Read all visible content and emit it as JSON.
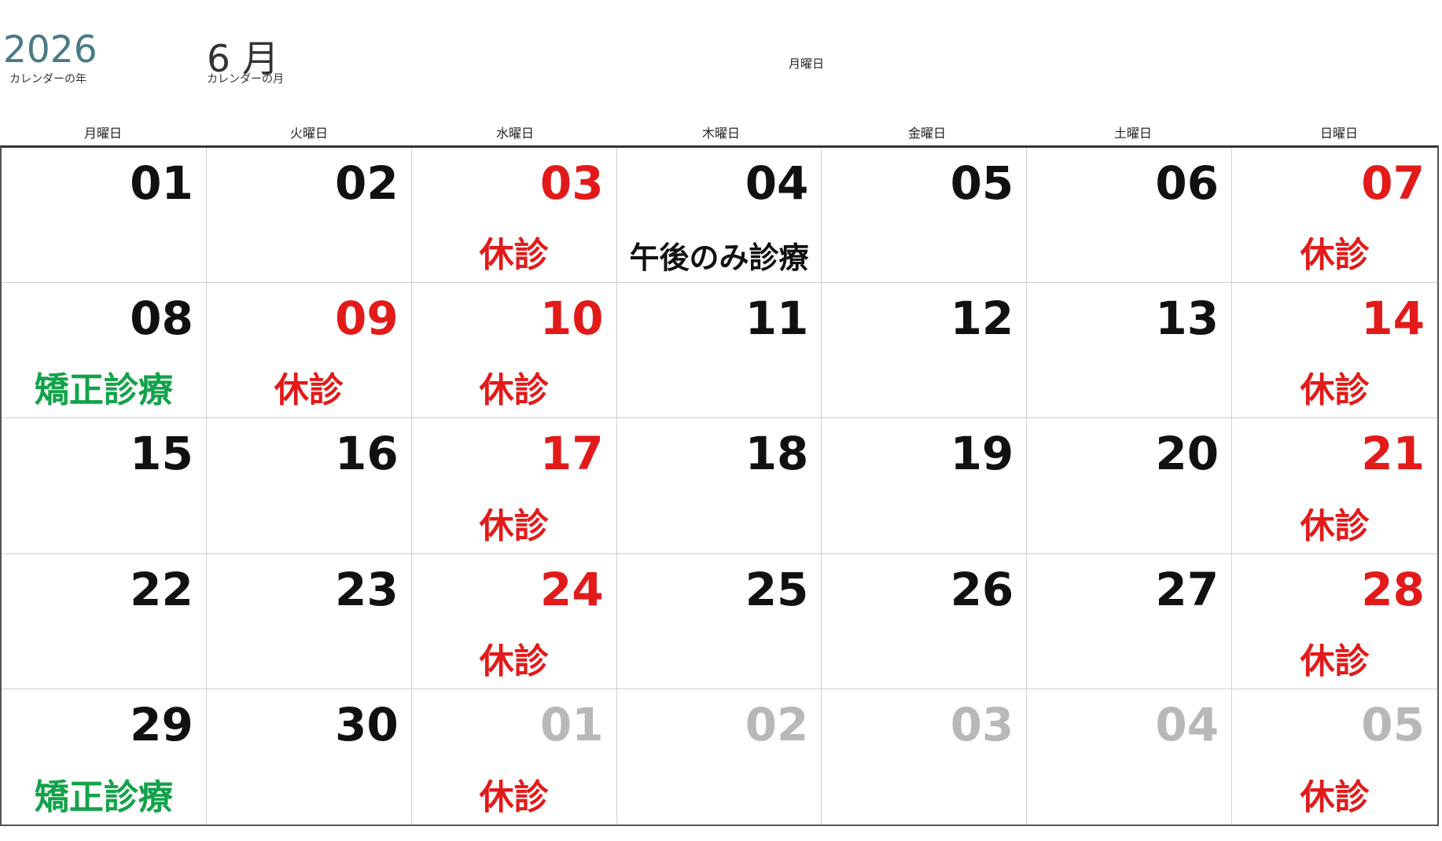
{
  "header": {
    "year": "2026",
    "year_caption": "カレンダーの年",
    "month": "6 月",
    "month_caption": "カレンダーの月",
    "center_label": "月曜日"
  },
  "weekdays": [
    "月曜日",
    "火曜日",
    "水曜日",
    "木曜日",
    "金曜日",
    "土曜日",
    "日曜日"
  ],
  "colors": {
    "holiday_red": "#e21a1a",
    "normal": "#111111",
    "other_month": "#b8b8b8",
    "ortho_green": "#13a24a"
  },
  "days": [
    {
      "day": "01",
      "color": "normal",
      "note": ""
    },
    {
      "day": "02",
      "color": "normal",
      "note": ""
    },
    {
      "day": "03",
      "color": "holiday_red",
      "note": "休診",
      "note_color": "holiday_red"
    },
    {
      "day": "04",
      "color": "normal",
      "note": "午後のみ診療",
      "note_color": "normal"
    },
    {
      "day": "05",
      "color": "normal",
      "note": ""
    },
    {
      "day": "06",
      "color": "normal",
      "note": ""
    },
    {
      "day": "07",
      "color": "holiday_red",
      "note": "休診",
      "note_color": "holiday_red"
    },
    {
      "day": "08",
      "color": "normal",
      "note": "矯正診療",
      "note_color": "ortho_green"
    },
    {
      "day": "09",
      "color": "holiday_red",
      "note": "休診",
      "note_color": "holiday_red"
    },
    {
      "day": "10",
      "color": "holiday_red",
      "note": "休診",
      "note_color": "holiday_red"
    },
    {
      "day": "11",
      "color": "normal",
      "note": ""
    },
    {
      "day": "12",
      "color": "normal",
      "note": ""
    },
    {
      "day": "13",
      "color": "normal",
      "note": ""
    },
    {
      "day": "14",
      "color": "holiday_red",
      "note": "休診",
      "note_color": "holiday_red"
    },
    {
      "day": "15",
      "color": "normal",
      "note": ""
    },
    {
      "day": "16",
      "color": "normal",
      "note": ""
    },
    {
      "day": "17",
      "color": "holiday_red",
      "note": "休診",
      "note_color": "holiday_red"
    },
    {
      "day": "18",
      "color": "normal",
      "note": ""
    },
    {
      "day": "19",
      "color": "normal",
      "note": ""
    },
    {
      "day": "20",
      "color": "normal",
      "note": ""
    },
    {
      "day": "21",
      "color": "holiday_red",
      "note": "休診",
      "note_color": "holiday_red"
    },
    {
      "day": "22",
      "color": "normal",
      "note": ""
    },
    {
      "day": "23",
      "color": "normal",
      "note": ""
    },
    {
      "day": "24",
      "color": "holiday_red",
      "note": "休診",
      "note_color": "holiday_red"
    },
    {
      "day": "25",
      "color": "normal",
      "note": ""
    },
    {
      "day": "26",
      "color": "normal",
      "note": ""
    },
    {
      "day": "27",
      "color": "normal",
      "note": ""
    },
    {
      "day": "28",
      "color": "holiday_red",
      "note": "休診",
      "note_color": "holiday_red"
    },
    {
      "day": "29",
      "color": "normal",
      "note": "矯正診療",
      "note_color": "ortho_green"
    },
    {
      "day": "30",
      "color": "normal",
      "note": ""
    },
    {
      "day": "01",
      "color": "other_month",
      "note": "休診",
      "note_color": "holiday_red"
    },
    {
      "day": "02",
      "color": "other_month",
      "note": ""
    },
    {
      "day": "03",
      "color": "other_month",
      "note": ""
    },
    {
      "day": "04",
      "color": "other_month",
      "note": ""
    },
    {
      "day": "05",
      "color": "other_month",
      "note": "休診",
      "note_color": "holiday_red"
    }
  ]
}
